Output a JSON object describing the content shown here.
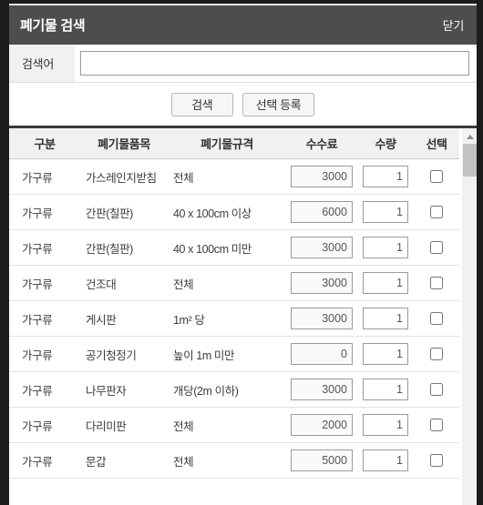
{
  "window": {
    "title": "폐기물 검색",
    "close_label": "닫기"
  },
  "search": {
    "label": "검색어",
    "value": "",
    "placeholder": ""
  },
  "actions": {
    "search_label": "검색",
    "register_label": "선택 등록"
  },
  "table": {
    "headers": {
      "gubun": "구분",
      "item": "폐기물품목",
      "spec": "폐기물규격",
      "fee": "수수료",
      "qty": "수량",
      "select": "선택"
    },
    "rows": [
      {
        "gubun": "가구류",
        "item": "가스레인지받침",
        "spec": "전체",
        "fee": "3000",
        "qty": "1",
        "checked": false
      },
      {
        "gubun": "가구류",
        "item": "간판(칠판)",
        "spec": "40 x 100cm 이상",
        "fee": "6000",
        "qty": "1",
        "checked": false
      },
      {
        "gubun": "가구류",
        "item": "간판(칠판)",
        "spec": "40 x 100cm 미만",
        "fee": "3000",
        "qty": "1",
        "checked": false
      },
      {
        "gubun": "가구류",
        "item": "건조대",
        "spec": "전체",
        "fee": "3000",
        "qty": "1",
        "checked": false
      },
      {
        "gubun": "가구류",
        "item": "게시판",
        "spec": "1m² 당",
        "fee": "3000",
        "qty": "1",
        "checked": false
      },
      {
        "gubun": "가구류",
        "item": "공기청정기",
        "spec": "높이 1m 미만",
        "fee": "0",
        "qty": "1",
        "checked": false
      },
      {
        "gubun": "가구류",
        "item": "나무판자",
        "spec": "개당(2m 이하)",
        "fee": "3000",
        "qty": "1",
        "checked": false
      },
      {
        "gubun": "가구류",
        "item": "다리미판",
        "spec": "전체",
        "fee": "2000",
        "qty": "1",
        "checked": false
      },
      {
        "gubun": "가구류",
        "item": "문갑",
        "spec": "전체",
        "fee": "5000",
        "qty": "1",
        "checked": false
      }
    ]
  },
  "scrollbar": {
    "up_arrow": "scroll-up-arrow"
  },
  "colors": {
    "titlebar": "#4d4d4d",
    "header_row": "#f1f1f1",
    "chrome": "#1c1c1c",
    "table_top_rule": "#3b3b3b"
  }
}
